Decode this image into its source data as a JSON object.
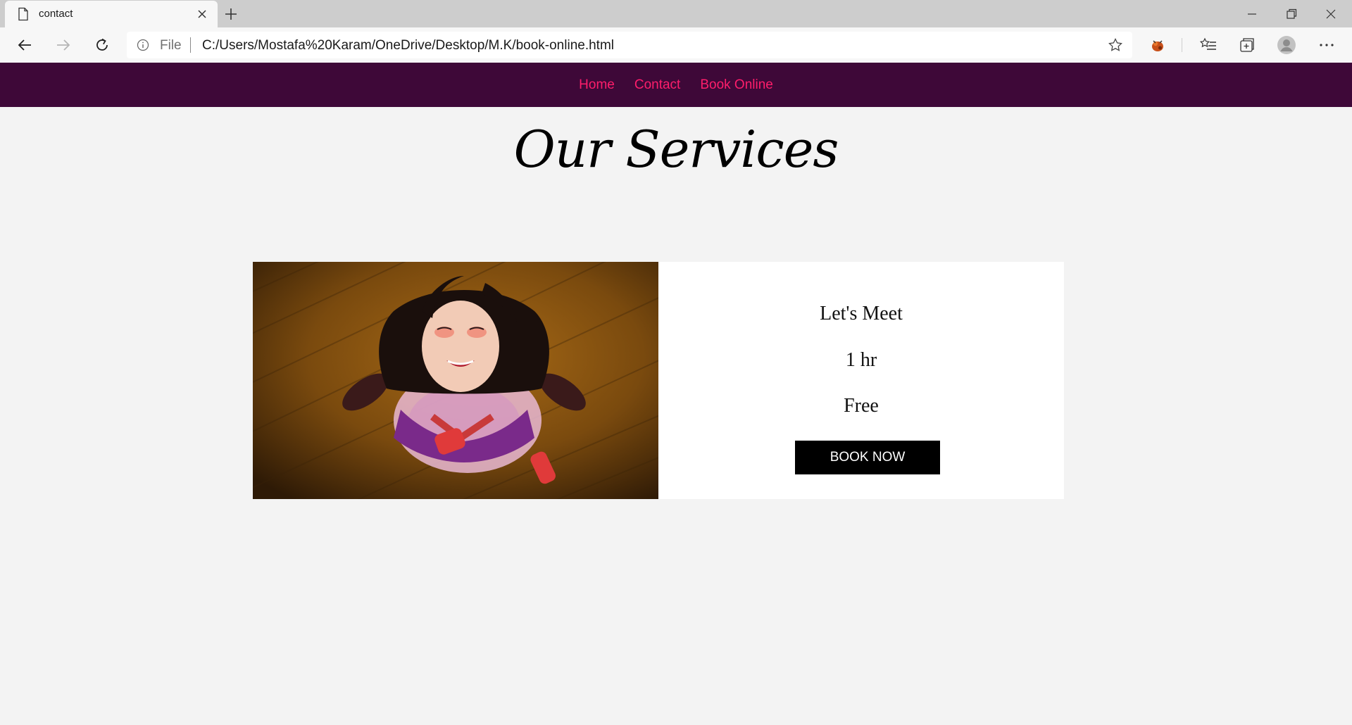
{
  "browser": {
    "tab_title": "contact",
    "address_scheme": "File",
    "url": "C:/Users/Mostafa%20Karam/OneDrive/Desktop/M.K/book-online.html"
  },
  "site_nav": {
    "links": [
      "Home",
      "Contact",
      "Book Online"
    ],
    "background": "#3e0838",
    "link_color": "#ff1d6b"
  },
  "page": {
    "title": "Our Services"
  },
  "service": {
    "name": "Let's Meet",
    "duration": "1 hr",
    "price": "Free",
    "button_label": "BOOK NOW"
  }
}
